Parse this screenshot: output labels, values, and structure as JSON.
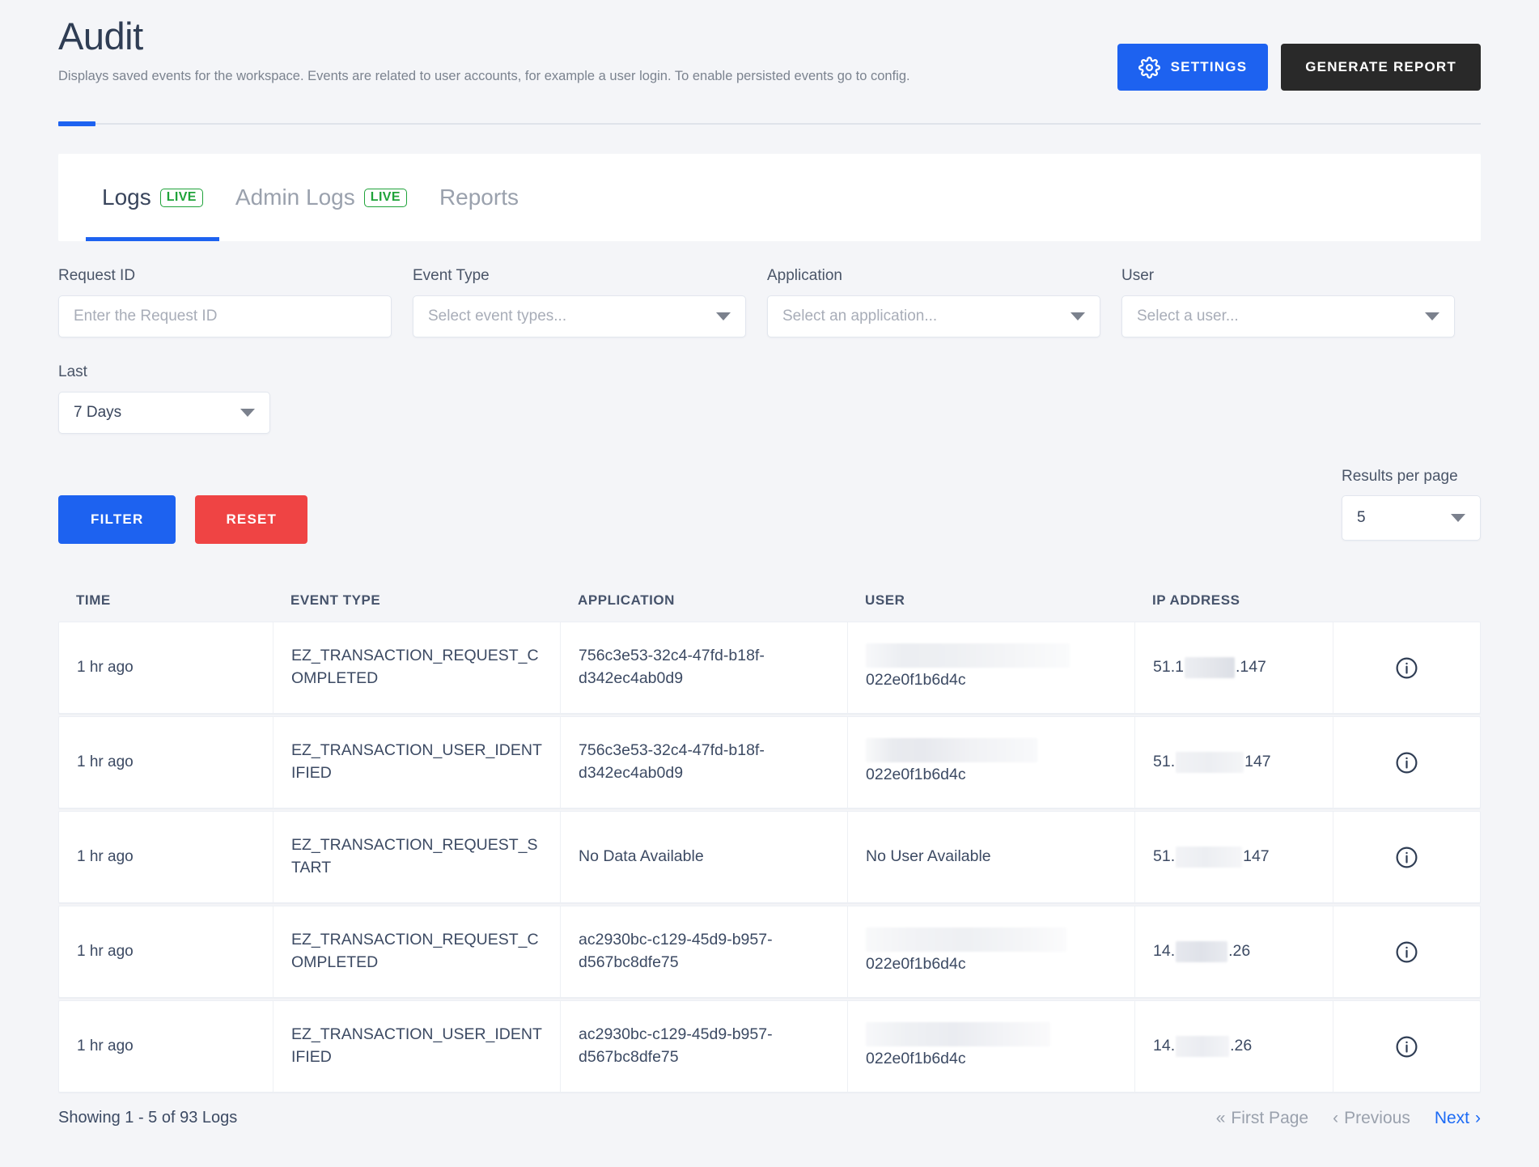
{
  "header": {
    "title": "Audit",
    "subtitle": "Displays saved events for the workspace. Events are related to user accounts, for example a user login. To enable persisted events go to config.",
    "settings_label": "SETTINGS",
    "generate_report_label": "GENERATE REPORT",
    "accent_color": "#1d62f0",
    "report_button_color": "#292929"
  },
  "tabs": [
    {
      "label": "Logs",
      "badge": "LIVE",
      "active": true
    },
    {
      "label": "Admin Logs",
      "badge": "LIVE",
      "active": false
    },
    {
      "label": "Reports",
      "badge": "",
      "active": false
    }
  ],
  "filters": {
    "request_id": {
      "label": "Request ID",
      "placeholder": "Enter the Request ID",
      "value": ""
    },
    "event_type": {
      "label": "Event Type",
      "value": "Select event types..."
    },
    "application": {
      "label": "Application",
      "value": "Select an application..."
    },
    "user": {
      "label": "User",
      "value": "Select a user..."
    },
    "last": {
      "label": "Last",
      "value": "7 Days"
    },
    "filter_button": "FILTER",
    "reset_button": "RESET",
    "filter_color": "#1d62f0",
    "reset_color": "#ef4444"
  },
  "results_per_page": {
    "label": "Results per page",
    "value": "5"
  },
  "table": {
    "columns": [
      "TIME",
      "EVENT TYPE",
      "APPLICATION",
      "USER",
      "IP ADDRESS"
    ],
    "rows": [
      {
        "time": "1 hr ago",
        "event_type": "EZ_TRANSACTION_REQUEST_COMPLETED",
        "application": "756c3e53-32c4-47fd-b18f-d342ec4ab0d9",
        "user_id": "022e0f1b6d4c",
        "user_redacted": true,
        "ip_prefix": "51.1",
        "ip_suffix": ".147",
        "info_icon": "info-icon"
      },
      {
        "time": "1 hr ago",
        "event_type": "EZ_TRANSACTION_USER_IDENTIFIED",
        "application": "756c3e53-32c4-47fd-b18f-d342ec4ab0d9",
        "user_id": "022e0f1b6d4c",
        "user_redacted": true,
        "ip_prefix": "51.",
        "ip_suffix": "147",
        "info_icon": "info-icon"
      },
      {
        "time": "1 hr ago",
        "event_type": "EZ_TRANSACTION_REQUEST_START",
        "application": "No Data Available",
        "user_id": "No User Available",
        "user_redacted": false,
        "ip_prefix": "51.",
        "ip_suffix": "147",
        "info_icon": "info-icon"
      },
      {
        "time": "1 hr ago",
        "event_type": "EZ_TRANSACTION_REQUEST_COMPLETED",
        "application": "ac2930bc-c129-45d9-b957-d567bc8dfe75",
        "user_id": "022e0f1b6d4c",
        "user_redacted": true,
        "ip_prefix": "14.",
        "ip_suffix": ".26",
        "info_icon": "info-icon"
      },
      {
        "time": "1 hr ago",
        "event_type": "EZ_TRANSACTION_USER_IDENTIFIED",
        "application": "ac2930bc-c129-45d9-b957-d567bc8dfe75",
        "user_id": "022e0f1b6d4c",
        "user_redacted": true,
        "ip_prefix": "14.",
        "ip_suffix": ".26",
        "info_icon": "info-icon"
      }
    ]
  },
  "footer": {
    "showing": "Showing 1 - 5 of 93 Logs",
    "first_page": "First Page",
    "previous": "Previous",
    "next": "Next",
    "next_color": "#1d6bf5"
  }
}
